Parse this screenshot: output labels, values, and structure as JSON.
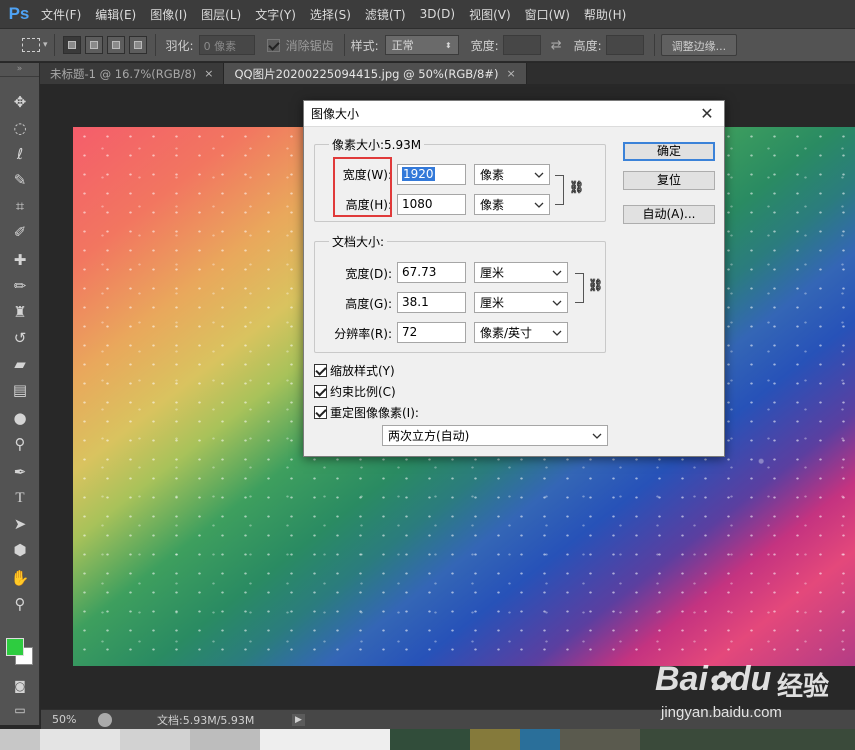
{
  "app": {
    "logo": "Ps"
  },
  "menu": [
    "文件(F)",
    "编辑(E)",
    "图像(I)",
    "图层(L)",
    "文字(Y)",
    "选择(S)",
    "滤镜(T)",
    "3D(D)",
    "视图(V)",
    "窗口(W)",
    "帮助(H)"
  ],
  "options": {
    "feather_label": "羽化:",
    "feather_value": "0 像素",
    "antialias_label": "消除锯齿",
    "style_label": "样式:",
    "style_value": "正常",
    "width_label": "宽度:",
    "height_label": "高度:",
    "refine_edge": "调整边缘..."
  },
  "tabs": [
    {
      "label": "未标题-1 @ 16.7%(RGB/8)",
      "close": "×"
    },
    {
      "label": "QQ图片20200225094415.jpg @ 50%(RGB/8#)",
      "close": "×"
    }
  ],
  "status": {
    "zoom": "50%",
    "doc": "文档:5.93M/5.93M"
  },
  "dialog": {
    "title": "图像大小",
    "pixel_dims": {
      "legend": "像素大小:5.93M",
      "width_label": "宽度(W):",
      "width_value": "1920",
      "width_unit": "像素",
      "height_label": "高度(H):",
      "height_value": "1080",
      "height_unit": "像素"
    },
    "doc_size": {
      "legend": "文档大小:",
      "width_label": "宽度(D):",
      "width_value": "67.73",
      "width_unit": "厘米",
      "height_label": "高度(G):",
      "height_value": "38.1",
      "height_unit": "厘米",
      "res_label": "分辨率(R):",
      "res_value": "72",
      "res_unit": "像素/英寸"
    },
    "checkboxes": {
      "scale_styles": "缩放样式(Y)",
      "constrain": "约束比例(C)",
      "resample": "重定图像像素(I):"
    },
    "resample_method": "两次立方(自动)",
    "buttons": {
      "ok": "确定",
      "reset": "复位",
      "auto": "自动(A)..."
    }
  },
  "watermark": {
    "brand": "Bai",
    "brand2": "du",
    "cn": "经验",
    "url": "jingyan.baidu.com"
  }
}
